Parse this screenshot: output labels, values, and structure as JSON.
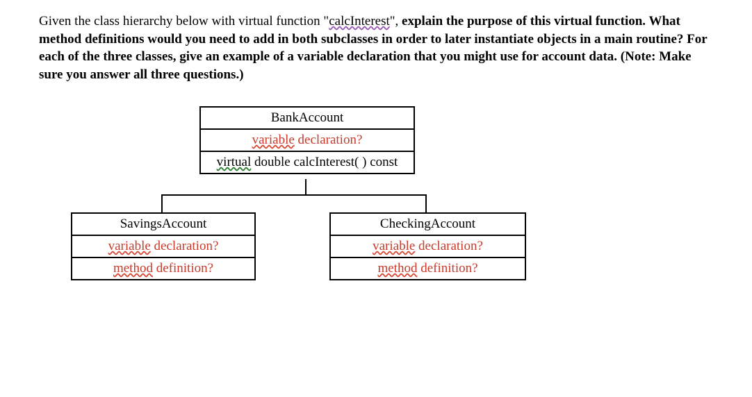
{
  "question": {
    "prefix": "Given the class hierarchy below with virtual function \"",
    "func_name": "calcInterest",
    "after_func": "\", ",
    "bold_rest": "explain the purpose of this virtual function. What method definitions would you need to add in both subclasses in order to later instantiate objects in a main routine? For each of the three classes, give an example of a variable declaration that you might use for account data. (Note: Make sure you answer all three questions.)"
  },
  "base_class": {
    "name": "BankAccount",
    "var_word": "variable",
    "var_rest": " declaration?",
    "virt_word": "virtual",
    "virt_rest": " double calcInterest( ) const"
  },
  "savings": {
    "name": "SavingsAccount",
    "var_word": "variable",
    "var_rest": " declaration?",
    "meth_word": "method",
    "meth_rest": " definition?"
  },
  "checking": {
    "name": "CheckingAccount",
    "var_word": "variable",
    "var_rest": " declaration?",
    "meth_word": "method",
    "meth_rest": " definition?"
  }
}
